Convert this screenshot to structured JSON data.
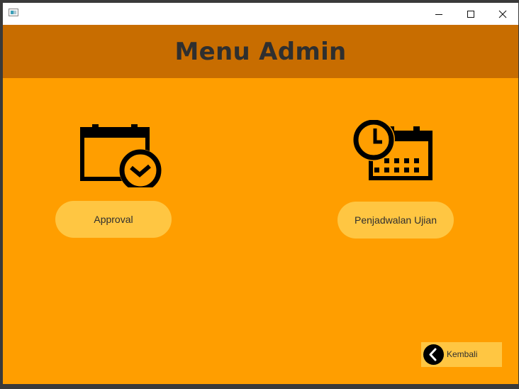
{
  "window": {
    "app_icon": "app-window-icon",
    "controls": {
      "minimize_icon": "minimize-icon",
      "maximize_icon": "maximize-icon",
      "close_icon": "close-icon"
    }
  },
  "header": {
    "title": "Menu Admin"
  },
  "menu": {
    "items": [
      {
        "icon": "calendar-check-icon",
        "label": "Approval"
      },
      {
        "icon": "calendar-clock-icon",
        "label": "Penjadwalan Ujian"
      }
    ]
  },
  "footer": {
    "back_icon": "chevron-left-icon",
    "back_label": "Kembali"
  },
  "colors": {
    "background": "#ff9e00",
    "header": "#c86d00",
    "button": "#ffc642",
    "text": "#2f2f2f"
  }
}
